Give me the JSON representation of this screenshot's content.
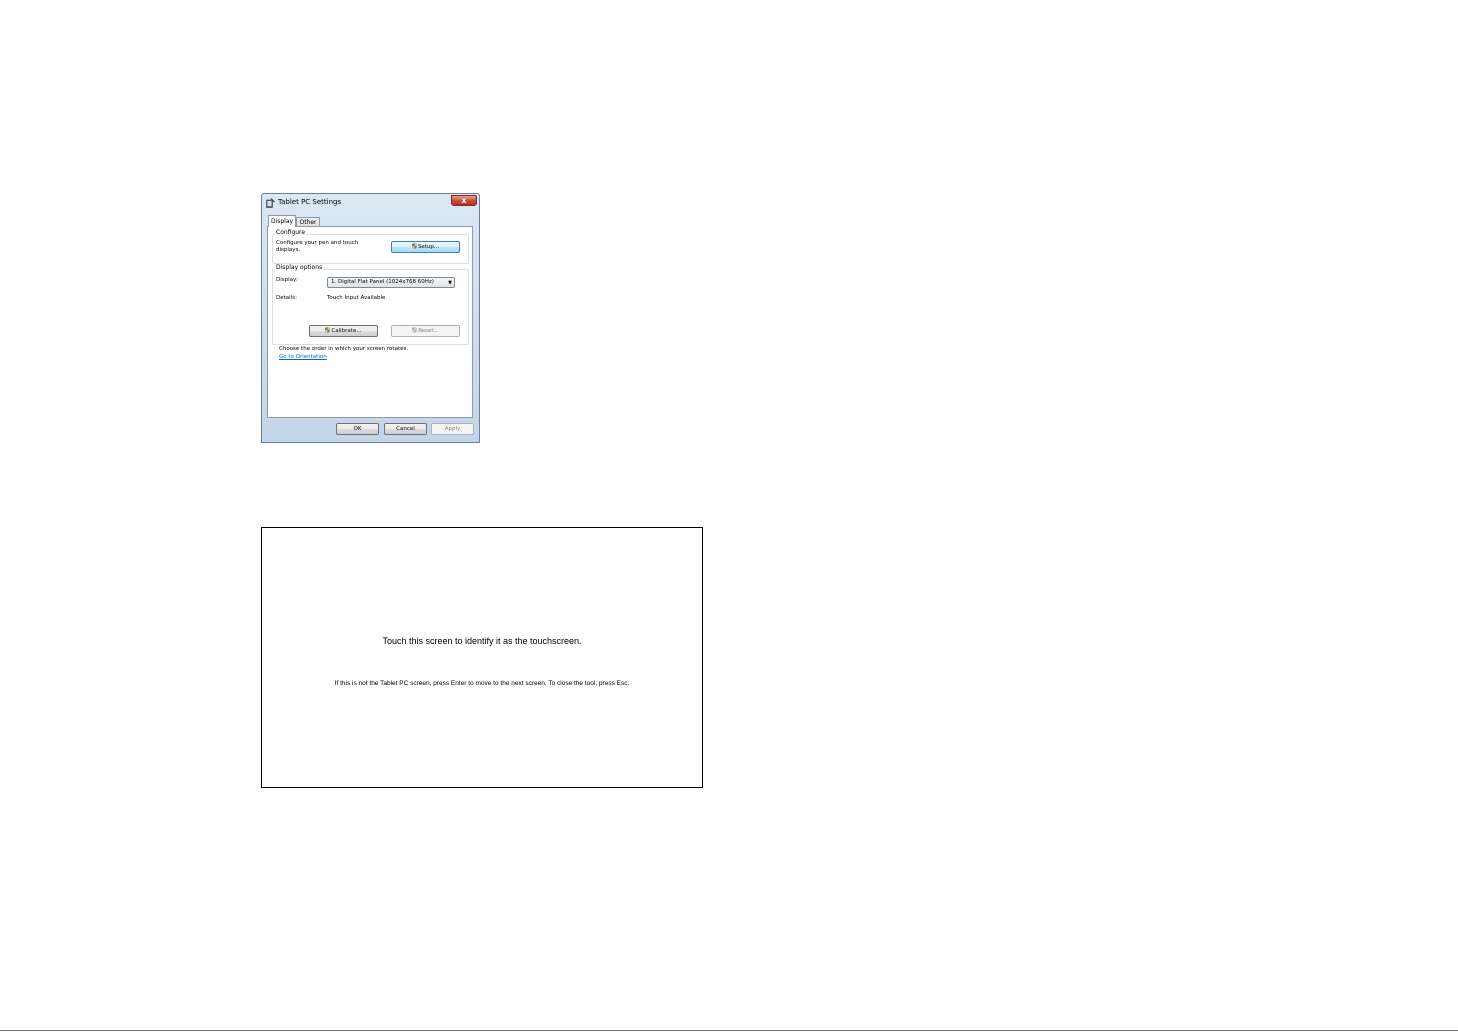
{
  "dialog": {
    "title": "Tablet PC Settings",
    "close_glyph": "x",
    "tabs": [
      {
        "label": "Display",
        "selected": true
      },
      {
        "label": "Other",
        "selected": false
      }
    ],
    "configure": {
      "group_title": "Configure",
      "description_line1": "Configure your pen and touch",
      "description_line2": "displays.",
      "setup_button": "Setup..."
    },
    "display_options": {
      "group_title": "Display options",
      "display_label": "Display:",
      "display_value": "1. Digital Flat Panel (1024x768 60Hz)",
      "details_label": "Details:",
      "details_value": "Touch Input Available",
      "calibrate_button": "Calibrate...",
      "reset_button": "Reset..."
    },
    "orientation_text": "Choose the order in which your screen rotates.",
    "orientation_link": "Go to Orientation",
    "footer": {
      "ok": "OK",
      "cancel": "Cancel",
      "apply": "Apply"
    },
    "icons": {
      "app": "tablet-pen-icon",
      "shield": "uac-shield-icon"
    },
    "colors": {
      "close_button": "#c64a33",
      "link": "#0066cc",
      "frame": "#c3d5ea"
    }
  },
  "touch_screen": {
    "main_text": "Touch this screen to identify it as the touchscreen.",
    "sub_text": "If this is not the Tablet PC screen, press Enter to move to the next screen. To close the tool, press Esc."
  }
}
